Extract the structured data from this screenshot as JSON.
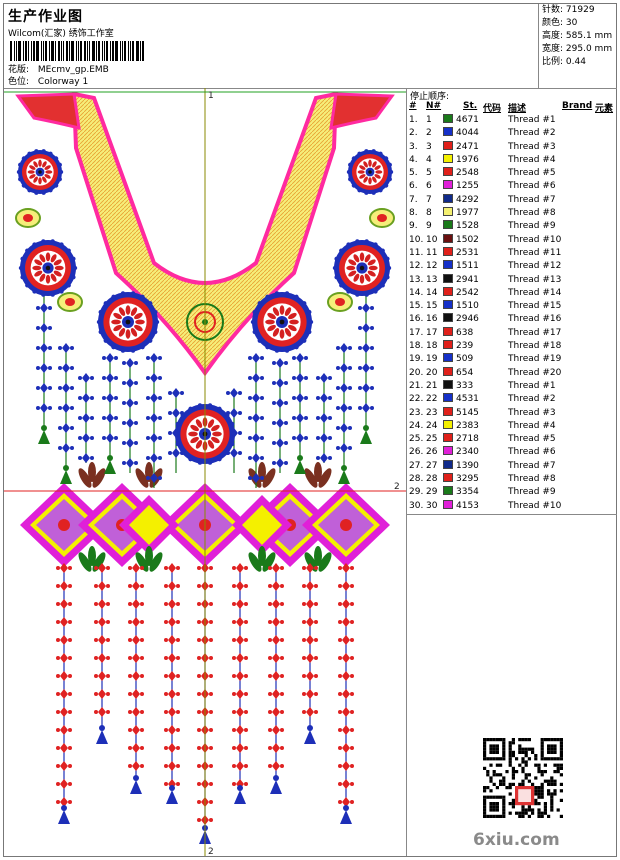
{
  "header": {
    "title": "生产作业图",
    "company": "Wilcom(汇家) 绣饰工作室",
    "design_label": "花版:",
    "design_value": "MEcmv_gp.EMB",
    "colorway_label": "色位:",
    "colorway_value": "Colorway 1"
  },
  "stats": {
    "stitches_label": "针数:",
    "stitches_value": "71929",
    "colors_label": "颜色:",
    "colors_value": "30",
    "height_label": "高度:",
    "height_value": "585.1 mm",
    "width_label": "宽度:",
    "width_value": "295.0 mm",
    "scale_label": "比例:",
    "scale_value": "0.44"
  },
  "panel": {
    "stop_sequence_title": "停止顺序:",
    "columns": {
      "num": "#",
      "n": "N#",
      "st": "St.",
      "code": "代码",
      "desc": "描述",
      "brand": "Brand",
      "element": "元素"
    }
  },
  "canvas": {
    "marker_1_top": "1",
    "marker_2_right": "2",
    "marker_2_bottom": "2"
  },
  "threads": [
    {
      "num": "1.",
      "n": "1",
      "st": "4671",
      "color": "#1a7a1a",
      "desc": "Thread #1"
    },
    {
      "num": "2.",
      "n": "2",
      "st": "4044",
      "color": "#1530c8",
      "desc": "Thread #2"
    },
    {
      "num": "3.",
      "n": "3",
      "st": "2471",
      "color": "#e0201a",
      "desc": "Thread #3"
    },
    {
      "num": "4.",
      "n": "4",
      "st": "1976",
      "color": "#f4f000",
      "desc": "Thread #4"
    },
    {
      "num": "5.",
      "n": "5",
      "st": "2548",
      "color": "#e0201a",
      "desc": "Thread #5"
    },
    {
      "num": "6.",
      "n": "6",
      "st": "1255",
      "color": "#e020d8",
      "desc": "Thread #6"
    },
    {
      "num": "7.",
      "n": "7",
      "st": "4292",
      "color": "#102a8a",
      "desc": "Thread #7"
    },
    {
      "num": "8.",
      "n": "8",
      "st": "1977",
      "color": "#f4f070",
      "desc": "Thread #8"
    },
    {
      "num": "9.",
      "n": "9",
      "st": "1528",
      "color": "#1a7a1a",
      "desc": "Thread #9"
    },
    {
      "num": "10.",
      "n": "10",
      "st": "1502",
      "color": "#6a1010",
      "desc": "Thread #10"
    },
    {
      "num": "11.",
      "n": "11",
      "st": "2531",
      "color": "#e0201a",
      "desc": "Thread #11"
    },
    {
      "num": "12.",
      "n": "12",
      "st": "1511",
      "color": "#1530c8",
      "desc": "Thread #12"
    },
    {
      "num": "13.",
      "n": "13",
      "st": "2941",
      "color": "#101010",
      "desc": "Thread #13"
    },
    {
      "num": "14.",
      "n": "14",
      "st": "2542",
      "color": "#e0201a",
      "desc": "Thread #14"
    },
    {
      "num": "15.",
      "n": "15",
      "st": "1510",
      "color": "#1530c8",
      "desc": "Thread #15"
    },
    {
      "num": "16.",
      "n": "16",
      "st": "2946",
      "color": "#101010",
      "desc": "Thread #16"
    },
    {
      "num": "17.",
      "n": "17",
      "st": "638",
      "color": "#e0201a",
      "desc": "Thread #17"
    },
    {
      "num": "18.",
      "n": "18",
      "st": "239",
      "color": "#e0201a",
      "desc": "Thread #18"
    },
    {
      "num": "19.",
      "n": "19",
      "st": "509",
      "color": "#1530c8",
      "desc": "Thread #19"
    },
    {
      "num": "20.",
      "n": "20",
      "st": "654",
      "color": "#e0201a",
      "desc": "Thread #20"
    },
    {
      "num": "21.",
      "n": "21",
      "st": "333",
      "color": "#101010",
      "desc": "Thread #1"
    },
    {
      "num": "22.",
      "n": "22",
      "st": "4531",
      "color": "#1530c8",
      "desc": "Thread #2"
    },
    {
      "num": "23.",
      "n": "23",
      "st": "5145",
      "color": "#e0201a",
      "desc": "Thread #3"
    },
    {
      "num": "24.",
      "n": "24",
      "st": "2383",
      "color": "#f4f000",
      "desc": "Thread #4"
    },
    {
      "num": "25.",
      "n": "25",
      "st": "2718",
      "color": "#e0201a",
      "desc": "Thread #5"
    },
    {
      "num": "26.",
      "n": "26",
      "st": "2340",
      "color": "#e020d8",
      "desc": "Thread #6"
    },
    {
      "num": "27.",
      "n": "27",
      "st": "1390",
      "color": "#102a8a",
      "desc": "Thread #7"
    },
    {
      "num": "28.",
      "n": "28",
      "st": "3295",
      "color": "#e0201a",
      "desc": "Thread #8"
    },
    {
      "num": "29.",
      "n": "29",
      "st": "3354",
      "color": "#1a7a1a",
      "desc": "Thread #9"
    },
    {
      "num": "30.",
      "n": "30",
      "st": "4153",
      "color": "#e020d8",
      "desc": "Thread #10"
    }
  ],
  "watermark": "6xiu.com"
}
